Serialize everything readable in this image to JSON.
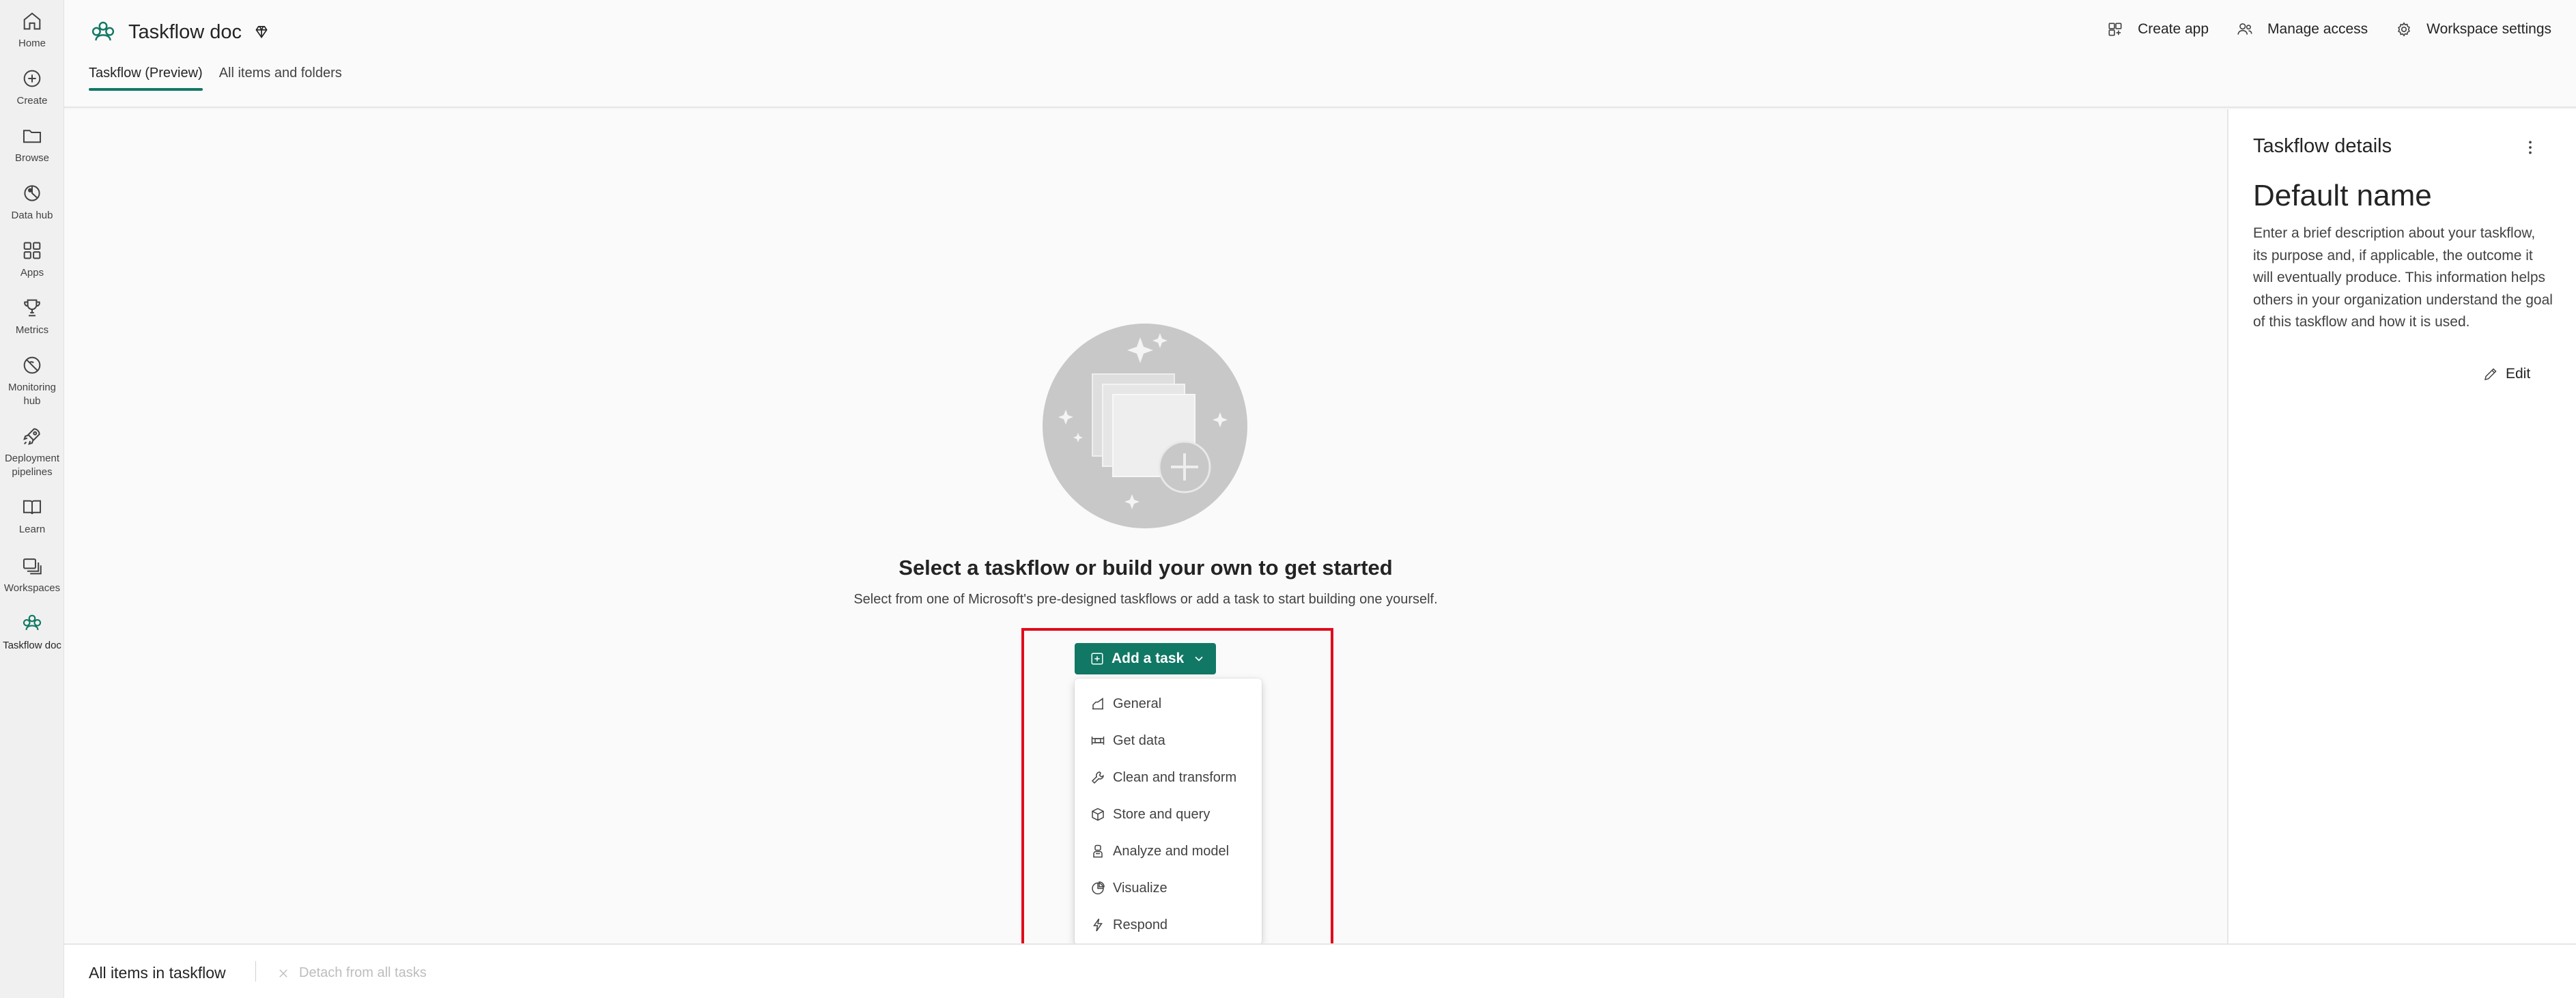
{
  "nav": {
    "items": [
      {
        "label": "Home",
        "icon": "home-icon"
      },
      {
        "label": "Create",
        "icon": "create-icon"
      },
      {
        "label": "Browse",
        "icon": "browse-icon"
      },
      {
        "label": "Data hub",
        "icon": "data-hub-icon"
      },
      {
        "label": "Apps",
        "icon": "apps-icon"
      },
      {
        "label": "Metrics",
        "icon": "metrics-icon"
      },
      {
        "label": "Monitoring hub",
        "icon": "monitoring-hub-icon"
      },
      {
        "label": "Deployment pipelines",
        "icon": "deployment-pipelines-icon"
      },
      {
        "label": "Learn",
        "icon": "learn-icon"
      },
      {
        "label": "Workspaces",
        "icon": "workspaces-icon"
      },
      {
        "label": "Taskflow doc",
        "icon": "taskflow-workspace-icon",
        "active": true
      }
    ]
  },
  "header": {
    "workspace_name": "Taskflow doc",
    "tabs": [
      {
        "label": "Taskflow (Preview)",
        "active": true
      },
      {
        "label": "All items and folders",
        "active": false
      }
    ],
    "actions": [
      {
        "label": "Create app",
        "icon": "create-app-icon"
      },
      {
        "label": "Manage access",
        "icon": "manage-access-icon"
      },
      {
        "label": "Workspace settings",
        "icon": "gear-icon"
      }
    ]
  },
  "empty_state": {
    "headline": "Select a taskflow or build your own to get started",
    "subline": "Select from one of Microsoft's pre-designed taskflows or add a task to start building one yourself."
  },
  "add_task": {
    "button_label": "Add a task",
    "menu": [
      {
        "label": "General",
        "icon": "general-icon"
      },
      {
        "label": "Get data",
        "icon": "get-data-icon"
      },
      {
        "label": "Clean and transform",
        "icon": "wrench-icon"
      },
      {
        "label": "Store and query",
        "icon": "cube-icon"
      },
      {
        "label": "Analyze and model",
        "icon": "flask-icon"
      },
      {
        "label": "Visualize",
        "icon": "pie-chart-icon"
      },
      {
        "label": "Respond",
        "icon": "lightning-icon"
      }
    ]
  },
  "bottom_bar": {
    "title": "All items in taskflow",
    "detach_label": "Detach from all tasks"
  },
  "details_panel": {
    "title": "Taskflow details",
    "name": "Default name",
    "description": "Enter a brief description about your taskflow, its purpose and, if applicable, the outcome it will eventually produce. This information helps others in your organization understand the goal of this taskflow and how it is used.",
    "edit_label": "Edit"
  },
  "colors": {
    "accent": "#117865",
    "highlight_border": "#e00b1c"
  }
}
